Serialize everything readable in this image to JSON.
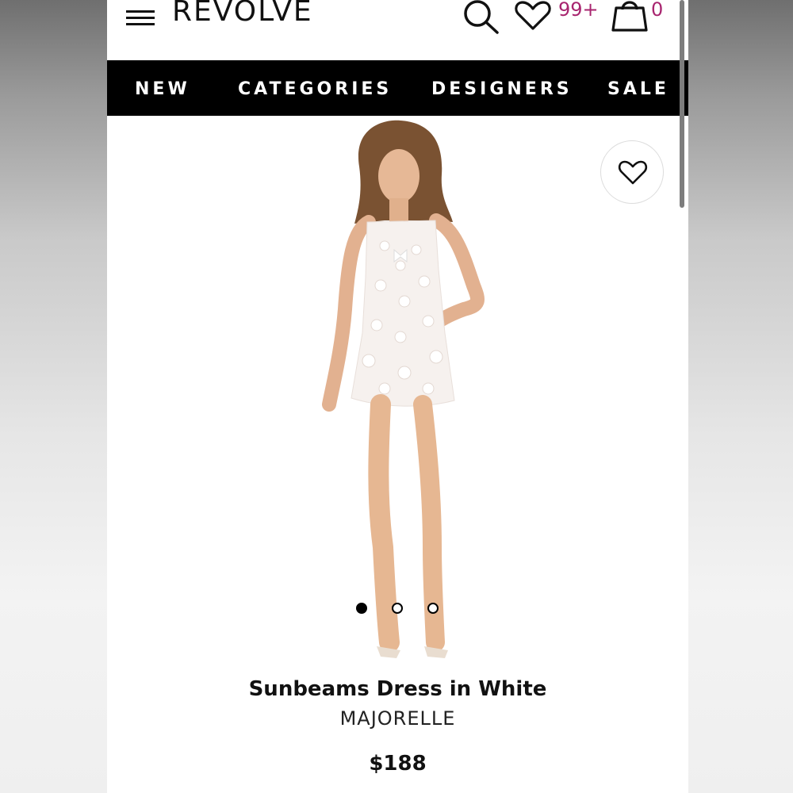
{
  "header": {
    "brand": "REVOLVE",
    "wishlist_count": "99+",
    "bag_count": "0",
    "accent_color": "#a8256f"
  },
  "nav": {
    "items": [
      {
        "label": "NEW"
      },
      {
        "label": "CATEGORIES"
      },
      {
        "label": "DESIGNERS"
      },
      {
        "label": "SALE"
      }
    ]
  },
  "product": {
    "name": "Sunbeams Dress in White",
    "brand": "MAJORELLE",
    "price": "$188",
    "image_count": 3,
    "active_image": 1
  },
  "icons": {
    "menu": "hamburger-menu-icon",
    "search": "search-icon",
    "wishlist": "heart-icon",
    "bag": "shopping-bag-icon",
    "favorite": "heart-outline-icon"
  }
}
